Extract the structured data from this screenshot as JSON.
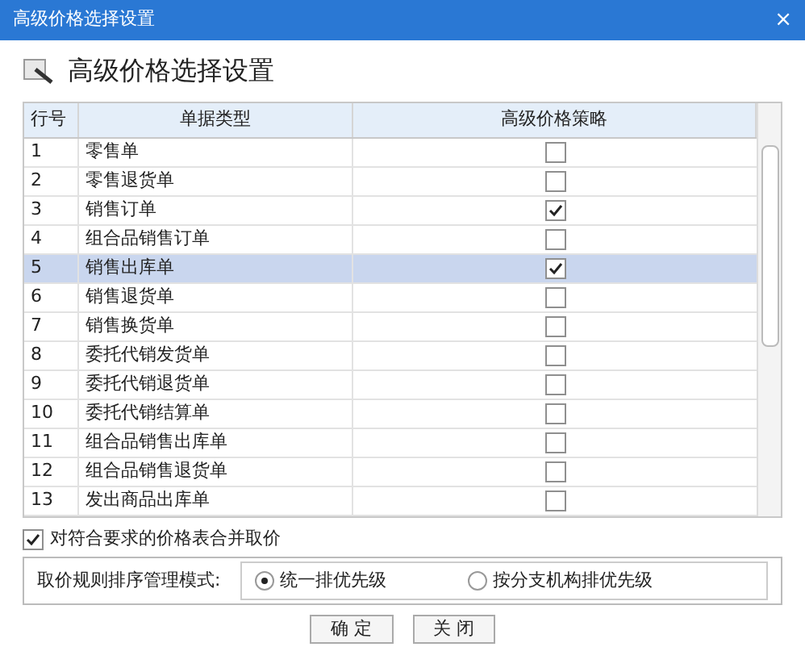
{
  "window": {
    "title": "高级价格选择设置",
    "close": "×"
  },
  "heading": "高级价格选择设置",
  "table": {
    "columns": [
      "行号",
      "单据类型",
      "高级价格策略"
    ],
    "rows": [
      {
        "no": "1",
        "type": "零售单",
        "checked": false,
        "selected": false
      },
      {
        "no": "2",
        "type": "零售退货单",
        "checked": false,
        "selected": false
      },
      {
        "no": "3",
        "type": "销售订单",
        "checked": true,
        "selected": false
      },
      {
        "no": "4",
        "type": "组合品销售订单",
        "checked": false,
        "selected": false
      },
      {
        "no": "5",
        "type": "销售出库单",
        "checked": true,
        "selected": true
      },
      {
        "no": "6",
        "type": "销售退货单",
        "checked": false,
        "selected": false
      },
      {
        "no": "7",
        "type": "销售换货单",
        "checked": false,
        "selected": false
      },
      {
        "no": "8",
        "type": "委托代销发货单",
        "checked": false,
        "selected": false
      },
      {
        "no": "9",
        "type": "委托代销退货单",
        "checked": false,
        "selected": false
      },
      {
        "no": "10",
        "type": "委托代销结算单",
        "checked": false,
        "selected": false
      },
      {
        "no": "11",
        "type": "组合品销售出库单",
        "checked": false,
        "selected": false
      },
      {
        "no": "12",
        "type": "组合品销售退货单",
        "checked": false,
        "selected": false
      },
      {
        "no": "13",
        "type": "发出商品出库单",
        "checked": false,
        "selected": false
      }
    ]
  },
  "merge_option": {
    "label": "对符合要求的价格表合并取价",
    "checked": true
  },
  "sort_mode": {
    "label": "取价规则排序管理模式:",
    "options": [
      {
        "label": "统一排优先级",
        "selected": true
      },
      {
        "label": "按分支机构排优先级",
        "selected": false
      }
    ]
  },
  "buttons": [
    "确 定",
    "关 闭"
  ]
}
